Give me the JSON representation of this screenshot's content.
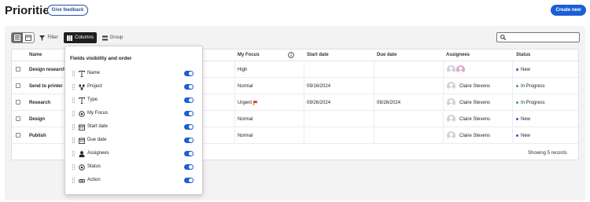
{
  "header": {
    "title": "Priorities",
    "feedback_label": "Give feedback",
    "create_label": "Create new"
  },
  "toolbar": {
    "filter_label": "Filter",
    "columns_label": "Columns",
    "group_label": "Group",
    "search_placeholder": ""
  },
  "table": {
    "columns": {
      "name": "Name",
      "my_focus": "My Focus",
      "start_date": "Start date",
      "due_date": "Due date",
      "assignees": "Assignees",
      "status": "Status"
    },
    "rows": [
      {
        "name": "Design research",
        "my_focus": "High",
        "start_date": "",
        "due_date": "",
        "assignee": "",
        "status": "New"
      },
      {
        "name": "Send to printer",
        "my_focus": "Normal",
        "start_date": "09/16/2024",
        "due_date": "",
        "assignee": "Claire Stevens",
        "status": "In Progress"
      },
      {
        "name": "Research",
        "my_focus": "Urgent",
        "start_date": "09/26/2024",
        "due_date": "09/26/2024",
        "assignee": "Claire Stevens",
        "status": "In Progress"
      },
      {
        "name": "Design",
        "my_focus": "Normal",
        "start_date": "",
        "due_date": "",
        "assignee": "Claire Stevens",
        "status": "New"
      },
      {
        "name": "Publish",
        "my_focus": "Normal",
        "start_date": "",
        "due_date": "",
        "assignee": "Claire Stevens",
        "status": "New"
      }
    ],
    "footer": "Showing 5 records"
  },
  "columns_popup": {
    "title": "Fields visibility and order",
    "fields": [
      {
        "label": "Name",
        "icon": "text-type-icon",
        "visible": true
      },
      {
        "label": "Project",
        "icon": "project-icon",
        "visible": true
      },
      {
        "label": "Type",
        "icon": "text-type-icon",
        "visible": true
      },
      {
        "label": "My Focus",
        "icon": "target-icon",
        "visible": true
      },
      {
        "label": "Start date",
        "icon": "calendar-icon",
        "visible": true
      },
      {
        "label": "Due date",
        "icon": "calendar-icon",
        "visible": true
      },
      {
        "label": "Assignees",
        "icon": "person-icon",
        "visible": true
      },
      {
        "label": "Status",
        "icon": "target-icon",
        "visible": true
      },
      {
        "label": "Action",
        "icon": "action-icon",
        "visible": true
      }
    ]
  },
  "colors": {
    "accent": "#1b5fd6",
    "status_new": "#1b5fd6",
    "status_in_progress": "#2fb05a",
    "urgent_flag": "#e0341f"
  }
}
